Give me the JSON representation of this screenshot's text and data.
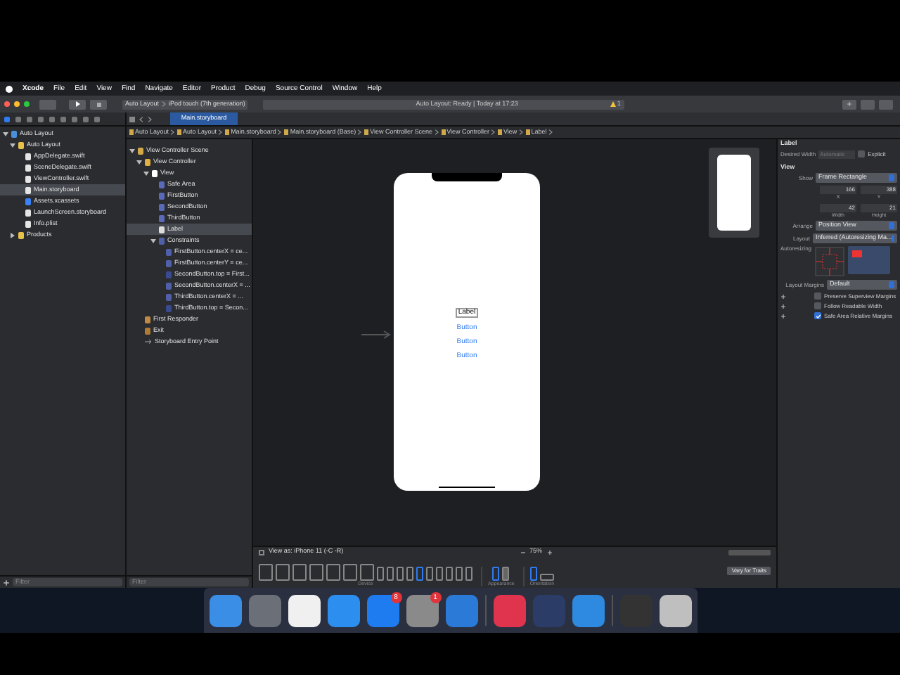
{
  "menu_bar": {
    "items": [
      "Xcode",
      "File",
      "Edit",
      "View",
      "Find",
      "Navigate",
      "Editor",
      "Product",
      "Debug",
      "Source Control",
      "Window",
      "Help"
    ]
  },
  "toolbar": {
    "scheme": "Auto Layout",
    "device": "iPod touch (7th generation)",
    "status": "Auto Layout: Ready | Today at 17:23",
    "warning_count": "1"
  },
  "editor_tab": {
    "label": "Main.storyboard",
    "selected": true
  },
  "breadcrumbs": [
    "Auto Layout",
    "Auto Layout",
    "Main.storyboard",
    "Main.storyboard (Base)",
    "View Controller Scene",
    "View Controller",
    "View",
    "Label"
  ],
  "navigator": [
    {
      "label": "Auto Layout",
      "kind": "project",
      "selected": false,
      "expanded": true,
      "children": [
        {
          "label": "Auto Layout",
          "kind": "folder",
          "selected": false,
          "expanded": true,
          "children": [
            {
              "label": "AppDelegate.swift",
              "kind": "file",
              "selected": false
            },
            {
              "label": "SceneDelegate.swift",
              "kind": "file",
              "selected": false
            },
            {
              "label": "ViewController.swift",
              "kind": "file",
              "selected": false
            },
            {
              "label": "Main.storyboard",
              "kind": "file",
              "selected": true
            },
            {
              "label": "Assets.xcassets",
              "kind": "assets",
              "selected": false
            },
            {
              "label": "LaunchScreen.storyboard",
              "kind": "file",
              "selected": false
            },
            {
              "label": "Info.plist",
              "kind": "file",
              "selected": false
            }
          ]
        },
        {
          "label": "Products",
          "kind": "folder",
          "selected": false,
          "expanded": false
        }
      ]
    }
  ],
  "outline": [
    {
      "label": "View Controller Scene",
      "kind": "scene",
      "selected": false,
      "expanded": true,
      "children": [
        {
          "label": "View Controller",
          "kind": "controller",
          "selected": false,
          "expanded": true,
          "children": [
            {
              "label": "View",
              "kind": "view",
              "selected": false,
              "expanded": true,
              "children": [
                {
                  "label": "Safe Area",
                  "kind": "item",
                  "selected": false
                },
                {
                  "label": "FirstButton",
                  "kind": "item",
                  "selected": false
                },
                {
                  "label": "SecondButton",
                  "kind": "item",
                  "selected": false
                },
                {
                  "label": "ThirdButton",
                  "kind": "item",
                  "selected": false
                },
                {
                  "label": "Label",
                  "kind": "label",
                  "selected": true
                },
                {
                  "label": "Constraints",
                  "kind": "constraint",
                  "selected": false,
                  "expanded": true,
                  "children": [
                    {
                      "label": "FirstButton.centerX = ce...",
                      "kind": "constraint",
                      "selected": false
                    },
                    {
                      "label": "FirstButton.centerY = ce...",
                      "kind": "constraint",
                      "selected": false
                    },
                    {
                      "label": "SecondButton.top = First...",
                      "kind": "spacing",
                      "selected": false
                    },
                    {
                      "label": "SecondButton.centerX = ...",
                      "kind": "constraint",
                      "selected": false
                    },
                    {
                      "label": "ThirdButton.centerX = ...",
                      "kind": "constraint",
                      "selected": false
                    },
                    {
                      "label": "ThirdButton.top = Secon...",
                      "kind": "spacing",
                      "selected": false
                    }
                  ]
                }
              ]
            }
          ]
        },
        {
          "label": "First Responder",
          "kind": "responder",
          "selected": false
        },
        {
          "label": "Exit",
          "kind": "exit",
          "selected": false
        },
        {
          "label": "Storyboard Entry Point",
          "kind": "entry",
          "selected": false
        }
      ]
    }
  ],
  "canvas": {
    "label": "Label",
    "buttons": [
      "Button",
      "Button",
      "Button"
    ]
  },
  "canvas_bar": {
    "view_as": "View as: iPhone 11 (‑C ‑R)",
    "zoom": "75%",
    "groups": [
      "Device",
      "Appearance",
      "Orientation"
    ],
    "vary_button": "Vary for Traits"
  },
  "filters": [
    {
      "placeholder": "Filter"
    },
    {
      "placeholder": "Filter"
    }
  ],
  "inspector": {
    "title": "Label",
    "desired_width_label": "Desired Width",
    "desired_width": "Automatic",
    "explicit": {
      "label": "Explicit",
      "checked": false
    },
    "section": "View",
    "show_label": "Show",
    "show": "Frame Rectangle",
    "fields": [
      {
        "label": "X",
        "value": "166"
      },
      {
        "label": "Y",
        "value": "388"
      },
      {
        "label": "Width",
        "value": "42"
      },
      {
        "label": "Height",
        "value": "21"
      }
    ],
    "arrange_label": "Arrange",
    "arrange": "Position View",
    "layout_label": "Layout",
    "layout": "Inferred (Autoresizing Ma...",
    "autoresizing_label": "Autoresizing",
    "margins_label": "Layout Margins",
    "margins": "Default",
    "options": [
      {
        "label": "Preserve Superview Margins",
        "checked": false
      },
      {
        "label": "Follow Readable Width",
        "checked": false
      },
      {
        "label": "Safe Area Relative Margins",
        "checked": true
      }
    ]
  },
  "dock": [
    {
      "kind": "finder"
    },
    {
      "kind": "launchpad"
    },
    {
      "kind": "chrome"
    },
    {
      "kind": "safari"
    },
    {
      "kind": "appstore",
      "badge": "8"
    },
    {
      "kind": "settings",
      "badge": "1"
    },
    {
      "kind": "xcode"
    },
    {
      "kind": "sep"
    },
    {
      "kind": "cloud"
    },
    {
      "kind": "quicktime"
    },
    {
      "kind": "instruments"
    },
    {
      "kind": "sep"
    },
    {
      "kind": "window"
    },
    {
      "kind": "trash"
    }
  ]
}
